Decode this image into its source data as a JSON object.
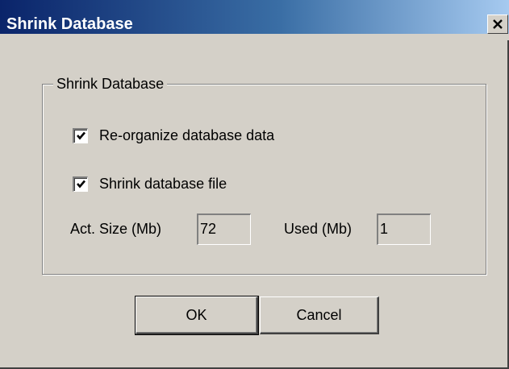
{
  "window": {
    "title": "Shrink Database",
    "close_glyph": "✕"
  },
  "group": {
    "legend": "Shrink Database",
    "options": [
      {
        "label": "Re-organize database data",
        "checked": true
      },
      {
        "label": "Shrink database file",
        "checked": true
      }
    ],
    "act_size_label": "Act. Size (Mb)",
    "act_size_value": "72",
    "used_label": "Used (Mb)",
    "used_value": "1"
  },
  "buttons": {
    "ok_label": "OK",
    "cancel_label": "Cancel"
  },
  "icons": {
    "check": "check-icon",
    "close": "close-icon"
  },
  "colors": {
    "title_start": "#0a246a",
    "title_end": "#a6caf0",
    "face": "#d4d0c8"
  }
}
